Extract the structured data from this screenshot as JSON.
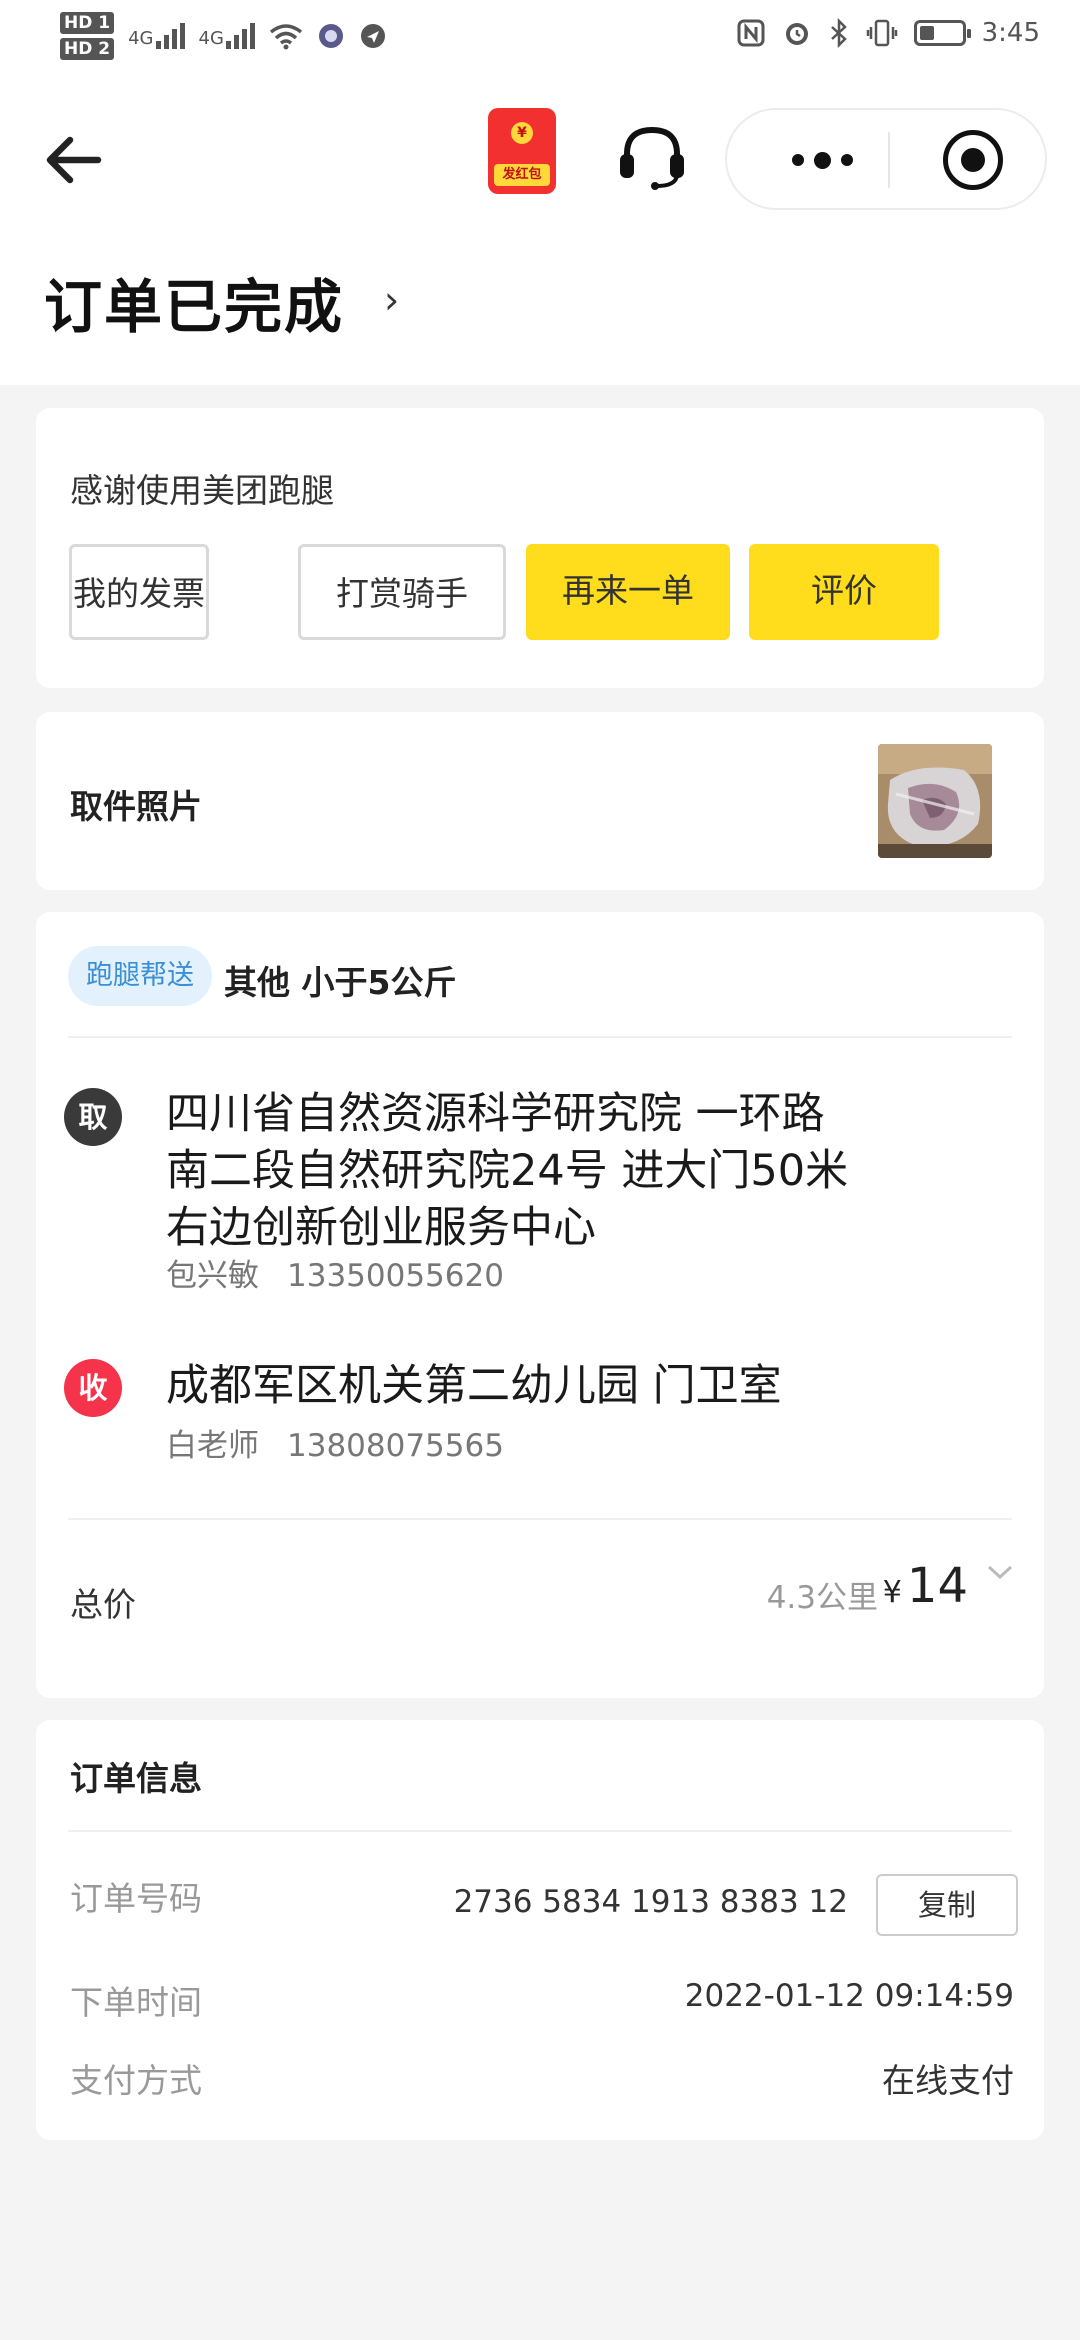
{
  "status_bar": {
    "sim1": "HD 1",
    "sim2": "HD 2",
    "net1": "4G",
    "net2": "4G",
    "time": "3:45",
    "icons": [
      "nfc-icon",
      "alarm-icon",
      "bluetooth-icon",
      "vibrate-icon",
      "battery-icon"
    ]
  },
  "nav": {
    "back_icon": "arrow-left-icon",
    "red_packet_label": "发红包",
    "red_packet_coin": "¥",
    "service_icon": "headset-icon",
    "more_icon": "more-dots-icon",
    "close_icon": "target-icon"
  },
  "order_status": {
    "title": "订单已完成",
    "chevron": "›"
  },
  "thanks_card": {
    "message": "感谢使用美团跑腿",
    "buttons": [
      "我的发票",
      "打赏骑手",
      "再来一单",
      "评价"
    ]
  },
  "photo_card": {
    "label": "取件照片"
  },
  "delivery_card": {
    "service_tag": "跑腿帮送",
    "goods": "其他  小于5公斤",
    "pickup": {
      "badge": "取",
      "address_lines": [
        "四川省自然资源科学研究院 一环路",
        "南二段自然研究院24号 进大门50米",
        "右边创新创业服务中心"
      ],
      "name": "包兴敏",
      "phone": "13350055620"
    },
    "receiver": {
      "badge": "收",
      "address": "成都军区机关第二幼儿园 门卫室",
      "name": "白老师",
      "phone": "13808075565"
    },
    "total_label": "总价",
    "distance": "4.3公里",
    "currency": "¥",
    "price": "14"
  },
  "order_info": {
    "title": "订单信息",
    "order_no_label": "订单号码",
    "order_no": "2736 5834 1913 8383 12",
    "copy_label": "复制",
    "time_label": "下单时间",
    "time_value": "2022-01-12  09:14:59",
    "pay_label": "支付方式",
    "pay_value": "在线支付"
  },
  "colors": {
    "accent_yellow": "#ffdd1c",
    "receive_red": "#f5334a",
    "pickup_dark": "#3a3a3a",
    "tag_blue": "#3a8fd6"
  }
}
